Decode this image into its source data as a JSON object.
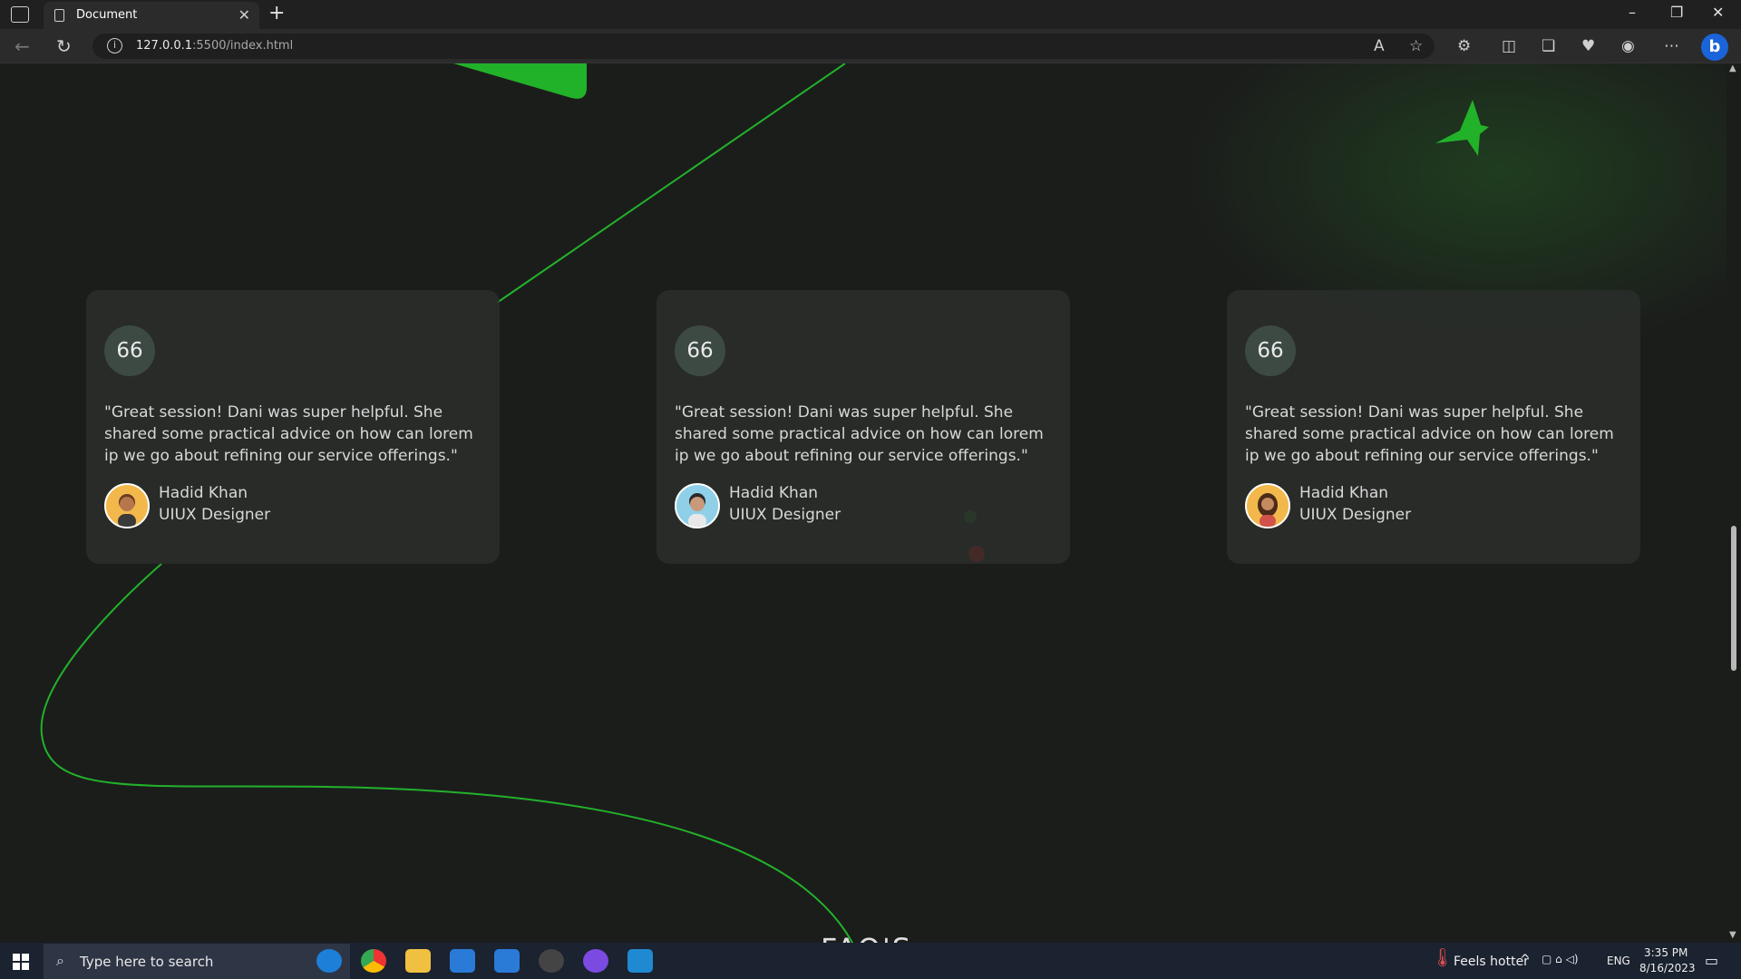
{
  "browser": {
    "tab_title": "Document",
    "url_host": "127.0.0.1",
    "url_path": ":5500/index.html"
  },
  "testimonials": [
    {
      "badge": "66",
      "review": "\"Great session! Dani was super helpful. She shared some practical advice on how can lorem ip we go about refining our service offerings.\"",
      "name": "Hadid Khan",
      "role": "UIUX Designer",
      "avatar_bg": "#f2b84b"
    },
    {
      "badge": "66",
      "review": "\"Great session! Dani was super helpful. She shared some practical advice on how can lorem ip we go about refining our service offerings.\"",
      "name": "Hadid Khan",
      "role": "UIUX Designer",
      "avatar_bg": "#8fd0e8"
    },
    {
      "badge": "66",
      "review": "\"Great session! Dani was super helpful. She shared some practical advice on how can lorem ip we go about refining our service offerings.\"",
      "name": "Hadid Khan",
      "role": "UIUX Designer",
      "avatar_bg": "#f2b84b"
    }
  ],
  "section_heading_partial": "FAQ'S",
  "taskbar": {
    "search_placeholder": "Type here to search",
    "weather": "Feels hotter",
    "lang": "ENG",
    "time": "3:35 PM",
    "date": "8/16/2023"
  },
  "colors": {
    "accent_green": "#22b22a",
    "page_bg": "#1b1d1b"
  }
}
